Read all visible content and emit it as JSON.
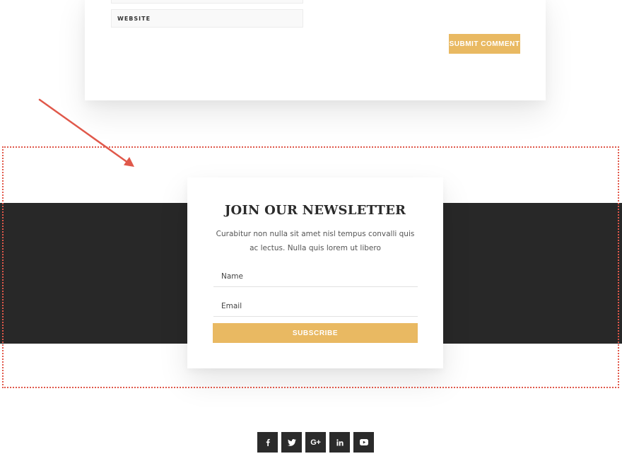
{
  "comment_form": {
    "website_placeholder": "WEBSITE",
    "submit_label": "SUBMIT COMMENT"
  },
  "newsletter": {
    "title": "JOIN OUR NEWSLETTER",
    "description": "Curabitur non nulla sit amet nisl tempus convalli quis ac lectus. Nulla quis lorem ut libero",
    "name_placeholder": "Name",
    "email_placeholder": "Email",
    "subscribe_label": "SUBSCRIBE"
  },
  "social": {
    "items": [
      {
        "icon": "facebook-icon"
      },
      {
        "icon": "twitter-icon"
      },
      {
        "icon": "google-plus-icon",
        "glyph": "G+"
      },
      {
        "icon": "linkedin-icon"
      },
      {
        "icon": "youtube-icon"
      }
    ]
  },
  "colors": {
    "accent": "#e9b962",
    "dark_band": "#282828",
    "highlight": "#e0584a",
    "social_bg": "#2b2b2b"
  }
}
